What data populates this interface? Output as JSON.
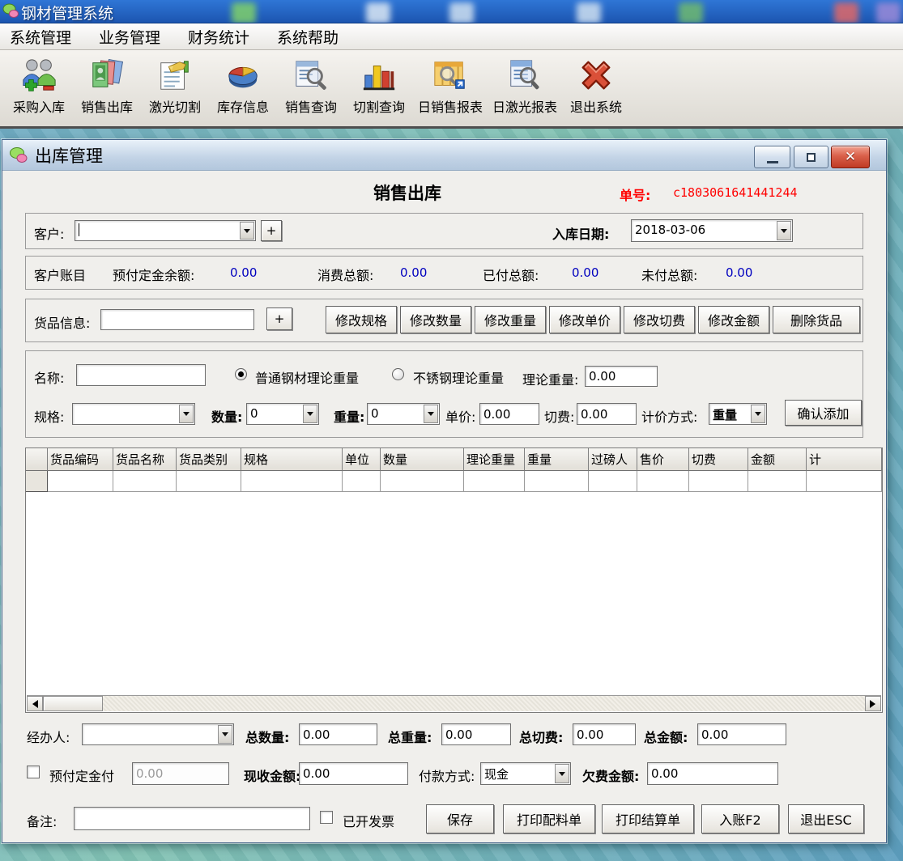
{
  "taskbar": {
    "app_title": "钢材管理系统"
  },
  "menu": {
    "items": [
      "系统管理",
      "业务管理",
      "财务统计",
      "系统帮助"
    ]
  },
  "toolbar": {
    "items": [
      {
        "label": "采购入库",
        "icon": "purchase-in-icon"
      },
      {
        "label": "销售出库",
        "icon": "sales-out-icon"
      },
      {
        "label": "激光切割",
        "icon": "laser-cut-icon"
      },
      {
        "label": "库存信息",
        "icon": "inventory-icon"
      },
      {
        "label": "销售查询",
        "icon": "sales-query-icon"
      },
      {
        "label": "切割查询",
        "icon": "cut-query-icon"
      },
      {
        "label": "日销售报表",
        "icon": "daily-sales-report-icon"
      },
      {
        "label": "日激光报表",
        "icon": "daily-laser-report-icon"
      },
      {
        "label": "退出系统",
        "icon": "exit-icon"
      }
    ]
  },
  "window": {
    "title": "出库管理",
    "form_title": "销售出库",
    "order": {
      "label": "单号:",
      "value": "c1803061641441244"
    },
    "customer": {
      "label": "客户:",
      "value": "",
      "add_button": "+"
    },
    "inbound_date": {
      "label": "入库日期:",
      "value": "2018-03-06"
    },
    "account": {
      "title": "客户账目",
      "prepaid_label": "预付定金余额:",
      "prepaid_value": "0.00",
      "consume_label": "消费总额:",
      "consume_value": "0.00",
      "paid_label": "已付总额:",
      "paid_value": "0.00",
      "unpaid_label": "未付总额:",
      "unpaid_value": "0.00"
    },
    "goods": {
      "label": "货品信息:",
      "value": "",
      "add_button": "+",
      "buttons": [
        "修改规格",
        "修改数量",
        "修改重量",
        "修改单价",
        "修改切费",
        "修改金额",
        "删除货品"
      ]
    },
    "entry": {
      "name_label": "名称:",
      "name_value": "",
      "radio_normal": "普通钢材理论重量",
      "radio_stainless": "不锈钢理论重量",
      "theory_label": "理论重量:",
      "theory_value": "0.00",
      "spec_label": "规格:",
      "spec_value": "",
      "qty_label": "数量:",
      "qty_value": "0",
      "weight_label": "重量:",
      "weight_value": "0",
      "price_label": "单价:",
      "price_value": "0.00",
      "cutfee_label": "切费:",
      "cutfee_value": "0.00",
      "pricing_label": "计价方式:",
      "pricing_value": "重量",
      "confirm_button": "确认添加"
    },
    "table": {
      "headers": [
        "",
        "货品编码",
        "货品名称",
        "货品类别",
        "规格",
        "单位",
        "数量",
        "理论重量",
        "重量",
        "过磅人",
        "售价",
        "切费",
        "金额",
        "计"
      ],
      "rows": [
        [
          "",
          "",
          "",
          "",
          "",
          "",
          "",
          "",
          "",
          "",
          "",
          "",
          "",
          ""
        ]
      ]
    },
    "totals": {
      "operator_label": "经办人:",
      "operator_value": "",
      "qty_label": "总数量:",
      "qty_value": "0.00",
      "weight_label": "总重量:",
      "weight_value": "0.00",
      "cutfee_label": "总切费:",
      "cutfee_value": "0.00",
      "amount_label": "总金额:",
      "amount_value": "0.00"
    },
    "payment": {
      "prepay_label": "预付定金付",
      "prepay_value": "0.00",
      "received_label": "现收金额:",
      "received_value": "0.00",
      "method_label": "付款方式:",
      "method_value": "现金",
      "arrears_label": "欠费金额:",
      "arrears_value": "0.00"
    },
    "footer": {
      "remark_label": "备注:",
      "remark_value": "",
      "invoiced_label": "已开发票",
      "buttons": [
        "保存",
        "打印配料单",
        "打印结算单",
        "入账F2",
        "退出ESC"
      ]
    }
  },
  "colors": {
    "taskbar_blue": "#2066c8",
    "value_blue": "#0000bf",
    "order_red": "#ff0000"
  }
}
